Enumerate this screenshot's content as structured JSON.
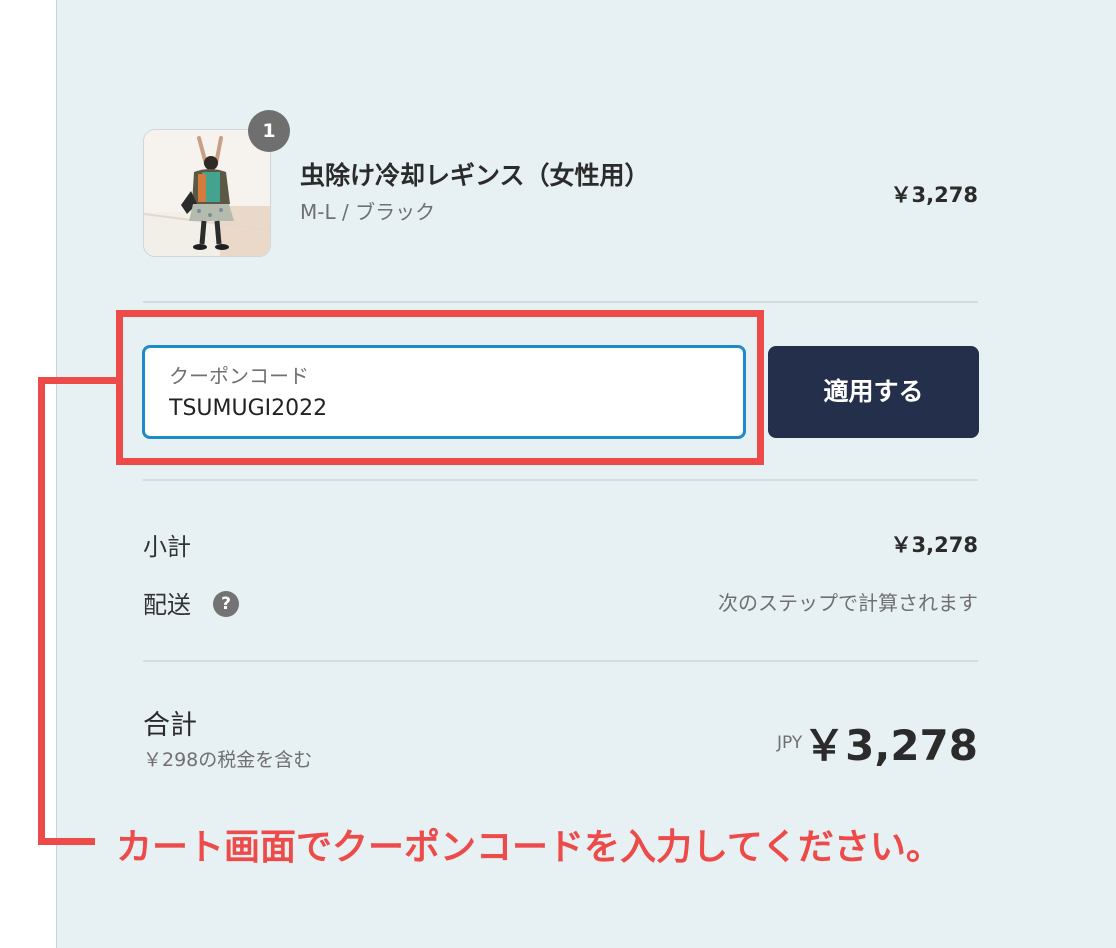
{
  "product": {
    "name": "虫除け冷却レギンス（女性用）",
    "variant": "M-L / ブラック",
    "price": "￥3,278",
    "quantity": "1",
    "image_icon": "product-photo"
  },
  "coupon": {
    "label": "クーポンコード",
    "value": "TSUMUGI2022",
    "apply_label": "適用する"
  },
  "totals": {
    "subtotal_label": "小計",
    "subtotal_value": "￥3,278",
    "shipping_label": "配送",
    "shipping_value": "次のステップで計算されます",
    "shipping_help_icon": "?",
    "total_label": "合計",
    "tax_note": "￥298の税金を含む",
    "currency": "JPY",
    "total_value": "￥3,278"
  },
  "annotation": {
    "text": "カート画面でクーポンコードを入力してください。",
    "color": "#ed4a4a"
  },
  "colors": {
    "panel_background": "#e7f1f3",
    "button_background": "#232f4b",
    "focus_border": "#1f8ac9"
  }
}
